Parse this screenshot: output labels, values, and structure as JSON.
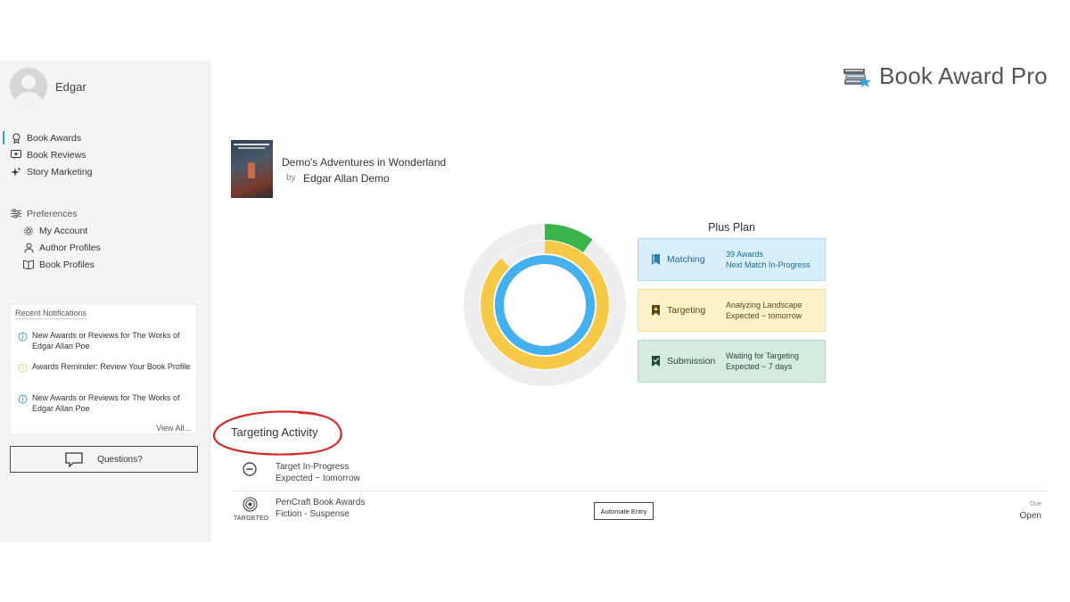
{
  "user": {
    "name": "Edgar"
  },
  "nav": {
    "main": [
      {
        "label": "Book Awards",
        "icon": "award-icon",
        "active": true
      },
      {
        "label": "Book Reviews",
        "icon": "review-icon"
      },
      {
        "label": "Story Marketing",
        "icon": "sparkle-icon"
      }
    ],
    "preferences_label": "Preferences",
    "preferences": [
      {
        "label": "My Account",
        "icon": "gear-icon"
      },
      {
        "label": "Author Profiles",
        "icon": "person-icon"
      },
      {
        "label": "Book Profiles",
        "icon": "book-icon"
      }
    ]
  },
  "notifications": {
    "title": "Recent Notifications",
    "items": [
      {
        "text": "New Awards or Reviews for The Works of Edgar Allan Poe",
        "type": "info"
      },
      {
        "text": "Awards Reminder: Review Your Book Profile",
        "type": "reminder"
      },
      {
        "text": "New Awards or Reviews for The Works of Edgar Allan Poe",
        "type": "info"
      }
    ],
    "view_all": "View All..."
  },
  "questions_label": "Questions?",
  "brand": {
    "name": "Book Award Pro"
  },
  "book": {
    "title": "Demo's Adventures in Wonderland",
    "by": "by",
    "author": "Edgar Allan Demo"
  },
  "progress": {
    "outer_fraction": 0.1,
    "middle_fraction": 0.88,
    "inner_fraction": 1.0,
    "colors": {
      "outer": "#3ab54a",
      "middle": "#f7c948",
      "inner": "#45b0f0",
      "track": "#eeeeee"
    }
  },
  "plan": {
    "title": "Plus Plan",
    "cards": [
      {
        "name": "Matching",
        "line1": "39 Awards",
        "line2": "Next Match In-Progress",
        "icon": "bookmark-icon"
      },
      {
        "name": "Targeting",
        "line1": "Analyzing Landscape",
        "line2": "Expected ~ tomorrow",
        "icon": "target-bookmark-icon"
      },
      {
        "name": "Submission",
        "line1": "Waiting for Targeting",
        "line2": "Expected ~ 7 days",
        "icon": "check-bookmark-icon"
      }
    ]
  },
  "activity": {
    "title": "Targeting Activity",
    "rows": [
      {
        "line1": "Target In-Progress",
        "line2": "Expected ~ tomorrow"
      },
      {
        "line1": "PenCraft Book Awards",
        "line2": "Fiction - Suspense",
        "tag": "TARGETED",
        "button": "Automate Entry",
        "due_label": "Due",
        "due_value": "Open"
      }
    ]
  }
}
